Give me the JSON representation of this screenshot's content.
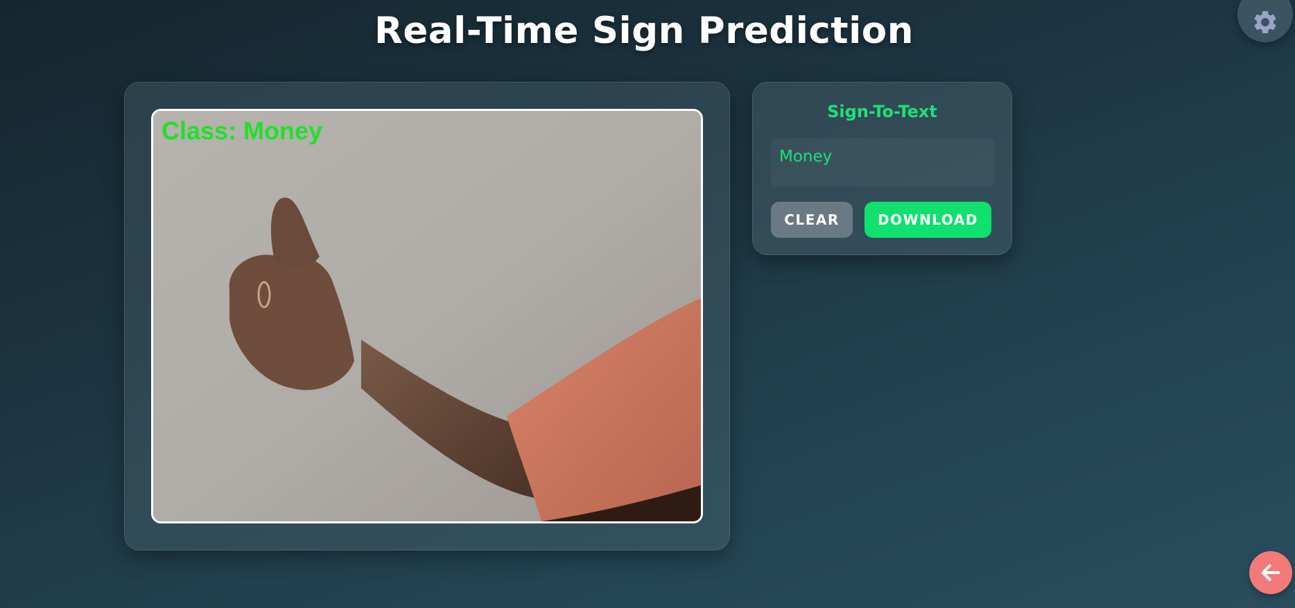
{
  "header": {
    "title": "Real-Time Sign Prediction"
  },
  "settings": {
    "icon": "gear-icon"
  },
  "video": {
    "overlay_label": "Class: Money",
    "overlay_color": "#22e02a"
  },
  "sign_to_text": {
    "title": "Sign-To-Text",
    "output_text": "Money",
    "clear_label": "CLEAR",
    "download_label": "DOWNLOAD",
    "accent_color": "#1ee07a"
  },
  "back": {
    "icon": "arrow-left-icon",
    "color": "#f47a7a"
  }
}
